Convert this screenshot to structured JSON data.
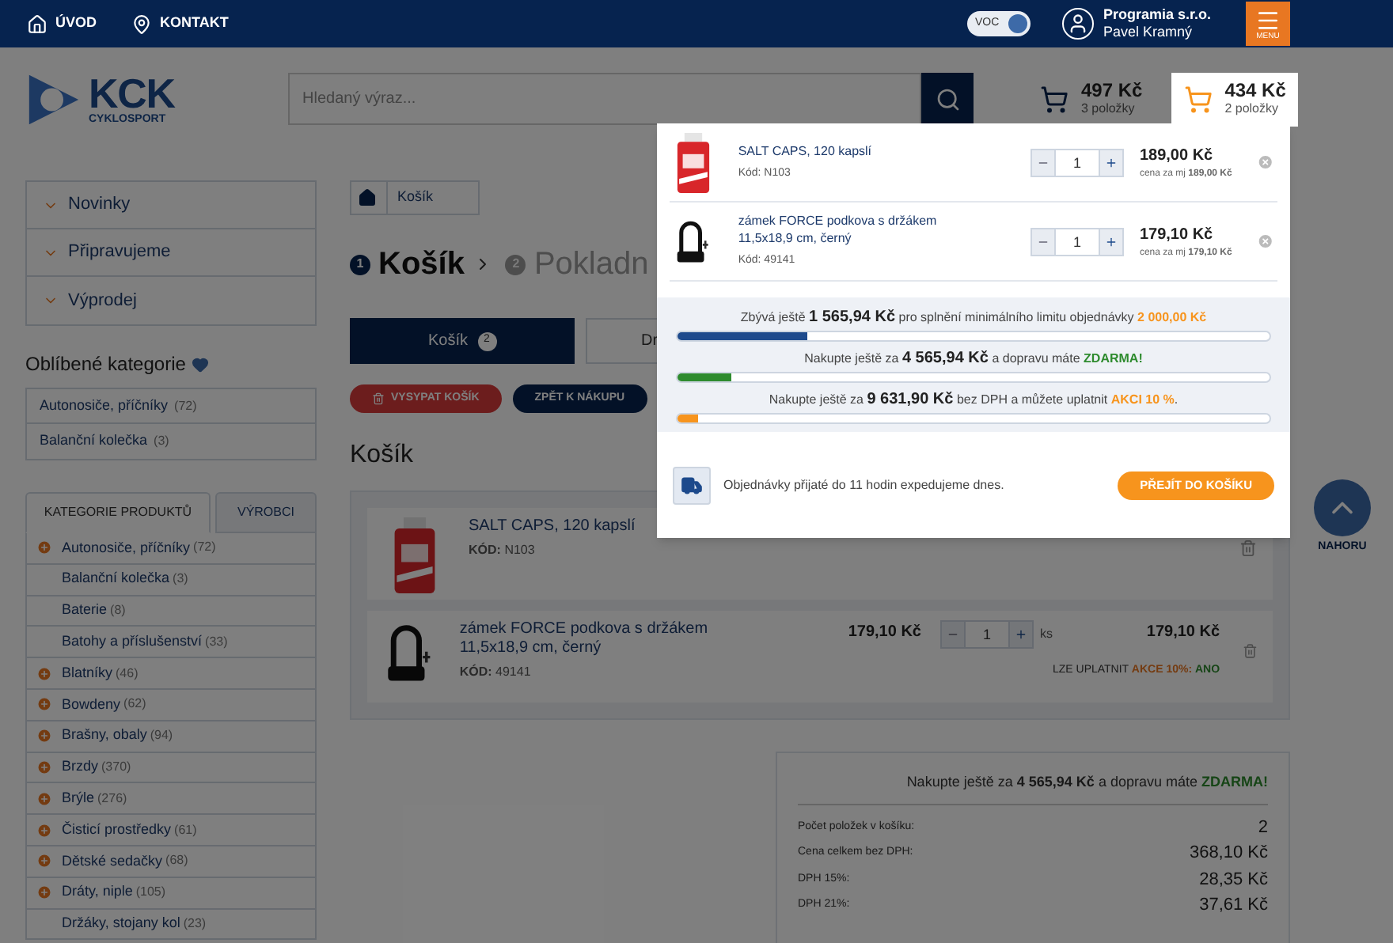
{
  "top_bar": {
    "links": [
      {
        "label": "ÚVOD",
        "kind": "home"
      },
      {
        "label": "KONTAKT",
        "kind": "pin"
      }
    ],
    "voc": {
      "label": "VOC",
      "on": true
    },
    "user": {
      "company": "Programia s.r.o.",
      "name": "Pavel Kramný"
    },
    "menu_button": {
      "label": "MENU"
    }
  },
  "header": {
    "logo": {
      "text": "KCK",
      "subtitle": "CYKLOSPORT"
    },
    "search": {
      "placeholder": "Hledaný výraz..."
    },
    "carts": [
      {
        "price": "497 Kč",
        "count": "3 položky",
        "selected": false
      },
      {
        "price": "434 Kč",
        "count": "2 položky",
        "selected": true
      }
    ]
  },
  "sidebar": {
    "menu": [
      {
        "label": "Novinky"
      },
      {
        "label": "Připravujeme"
      },
      {
        "label": "Výprodej"
      }
    ],
    "favourites_title": "Oblíbené kategorie",
    "favourites": [
      {
        "name": "Autonosiče, příčníky",
        "count": "(72)"
      },
      {
        "name": "Balanční kolečka",
        "count": "(3)"
      }
    ],
    "tabs": [
      {
        "label": "KATEGORIE PRODUKTŮ",
        "selected": true
      },
      {
        "label": "VÝROBCI",
        "selected": false
      }
    ],
    "categories": [
      {
        "name": "Autonosiče, příčníky",
        "count": "(72)",
        "expandable": true
      },
      {
        "name": "Balanční kolečka",
        "count": "(3)",
        "expandable": false
      },
      {
        "name": "Baterie",
        "count": "(8)",
        "expandable": false
      },
      {
        "name": "Batohy a příslušenství",
        "count": "(33)",
        "expandable": false
      },
      {
        "name": "Blatníky",
        "count": "(46)",
        "expandable": true
      },
      {
        "name": "Bowdeny",
        "count": "(62)",
        "expandable": true
      },
      {
        "name": "Brašny, obaly",
        "count": "(94)",
        "expandable": true
      },
      {
        "name": "Brzdy",
        "count": "(370)",
        "expandable": true
      },
      {
        "name": "Brýle",
        "count": "(276)",
        "expandable": true
      },
      {
        "name": "Čisticí prostředky",
        "count": "(61)",
        "expandable": true
      },
      {
        "name": "Dětské sedačky",
        "count": "(68)",
        "expandable": true
      },
      {
        "name": "Dráty, niple",
        "count": "(105)",
        "expandable": true
      },
      {
        "name": "Držáky, stojany kol",
        "count": "(23)",
        "expandable": false
      }
    ]
  },
  "main": {
    "breadcrumb": [
      "Košík"
    ],
    "steps": [
      {
        "number": "1",
        "label": "Košík",
        "selected": true
      },
      {
        "number": "2",
        "label": "Pokladn",
        "selected": false
      }
    ],
    "view_tabs": [
      {
        "label": "Košík",
        "badge": "2",
        "selected": true
      },
      {
        "label": "Dr",
        "selected": false
      }
    ],
    "actions": [
      {
        "label": "VYSYPAT KOŠÍK",
        "kind": "danger"
      },
      {
        "label": "ZPĚT K NÁKUPU",
        "kind": "primary"
      }
    ],
    "section_title": "Košík",
    "cart_rows": [
      {
        "kind": "bottle",
        "name": "SALT CAPS, 120 kapslí",
        "code_label": "KÓD:",
        "code": "N103"
      },
      {
        "kind": "lock",
        "name": "zámek FORCE podkova s držákem 11,5x18,9 cm, černý",
        "code_label": "KÓD:",
        "code": "49141",
        "price": "179,10 Kč",
        "quantity": "1",
        "unit": "ks",
        "total": "179,10 Kč",
        "promo": {
          "label": "LZE UPLATNIT",
          "action": "AKCE 10%:",
          "value": "ANO"
        }
      }
    ],
    "summary": {
      "free_shipping": {
        "prefix": "Nakupte ještě za",
        "amount": "4 565,94 Kč",
        "middle": "a dopravu máte",
        "highlight": "ZDARMA!"
      },
      "rows": [
        {
          "label": "Počet položek v košíku:",
          "value": "2"
        },
        {
          "label": "Cena celkem bez DPH:",
          "value": "368,10 Kč"
        },
        {
          "label": "DPH 15%:",
          "value": "28,35 Kč"
        },
        {
          "label": "DPH 21%:",
          "value": "37,61 Kč"
        }
      ]
    }
  },
  "cart_dropdown": {
    "items": [
      {
        "kind": "bottle",
        "name": "SALT CAPS, 120 kapslí",
        "code": "Kód: N103",
        "quantity": "1",
        "price": "189,00 Kč",
        "unit_label": "cena za mj",
        "unit_price": "189,00 Kč"
      },
      {
        "kind": "lock",
        "name": "zámek FORCE podkova s držákem 11,5x18,9 cm, černý",
        "code": "Kód: 49141",
        "quantity": "1",
        "price": "179,10 Kč",
        "unit_label": "cena za mj",
        "unit_price": "179,10 Kč"
      }
    ],
    "progress": [
      {
        "prefix": "Zbývá ještě",
        "amount": "1 565,94 Kč",
        "middle": "pro splnění minimálního limitu objednávky",
        "highlight": "2 000,00 Kč",
        "kind": "limit",
        "color": "#1d4a8c",
        "level": 0.22
      },
      {
        "prefix": "Nakupte ještě za",
        "amount": "4 565,94 Kč",
        "middle": "a dopravu máte",
        "highlight": "ZDARMA!",
        "kind": "shipping",
        "color": "#2e8b2e",
        "level": 0.09
      },
      {
        "prefix": "Nakupte ještě za",
        "amount": "9 631,90 Kč",
        "middle": "bez DPH a můžete uplatnit",
        "highlight": "AKCI 10 %",
        "suffix": ".",
        "kind": "discount",
        "color": "#f7941d",
        "level": 0.035
      }
    ],
    "shipping_note": "Objednávky přijaté do 11 hodin expedujeme dnes.",
    "checkout_button": "PŘEJÍT DO KOŠÍKU"
  },
  "back_to_top": {
    "label": "NAHORU"
  }
}
